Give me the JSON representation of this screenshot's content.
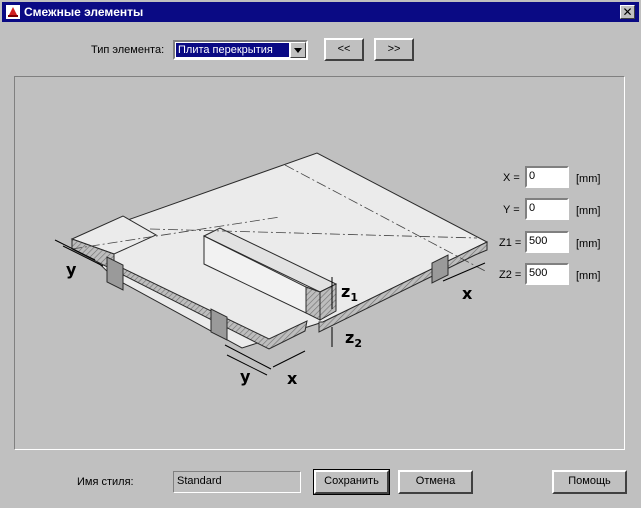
{
  "window": {
    "title": "Смежные элементы",
    "close_glyph": "✕"
  },
  "element_type": {
    "label": "Тип элемента:",
    "selected": "Плита перекрытия",
    "prev_label": "<<",
    "next_label": ">>"
  },
  "diagram": {
    "label_y_left": "y",
    "label_y_bottom": "y",
    "label_x_bottom": "x",
    "label_x_right": "x",
    "label_z1": "z",
    "label_z1_sub": "1",
    "label_z2": "z",
    "label_z2_sub": "2"
  },
  "params": {
    "x_label": "X =",
    "x_value": "0",
    "y_label": "Y =",
    "y_value": "0",
    "z1_label": "Z1 =",
    "z1_value": "500",
    "z2_label": "Z2 =",
    "z2_value": "500",
    "unit": "[mm]"
  },
  "footer": {
    "style_label": "Имя стиля:",
    "style_value": "Standard",
    "save_label": "Сохранить",
    "cancel_label": "Отмена",
    "help_label": "Помощь"
  },
  "colors": {
    "titlebar": "#0a0a84",
    "face": "#c0c0c0",
    "slab_top": "#ebebeb"
  }
}
